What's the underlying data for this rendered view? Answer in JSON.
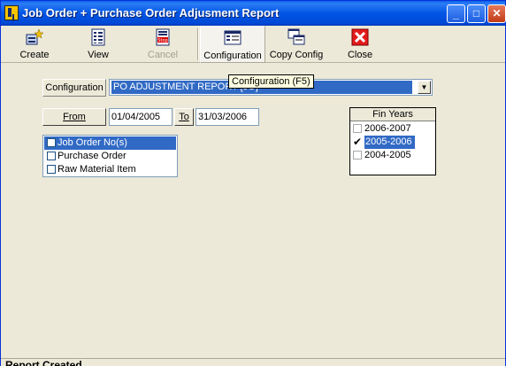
{
  "window": {
    "title": "Job Order + Purchase Order Adjusment Report",
    "controls": {
      "minimize": "_",
      "maximize": "□",
      "close": "✕"
    }
  },
  "toolbar": {
    "create_label": "Create",
    "view_label": "View",
    "cancel_label": "Cancel",
    "configuration_label": "Configuration",
    "copy_config_label": "Copy Config",
    "close_label": "Close"
  },
  "tooltip": {
    "text": "Configuration  (F5)"
  },
  "config": {
    "label": "Configuration",
    "selected_value": "PO ADJUSTMENT REPORT [JO]",
    "dropdown_arrow": "▼"
  },
  "dates": {
    "from_label": "From",
    "from_value": "01/04/2005",
    "to_label": "To",
    "to_value": "31/03/2006"
  },
  "filters": [
    {
      "label": "Job Order No(s)",
      "checked": false,
      "selected": true
    },
    {
      "label": "Purchase Order",
      "checked": false,
      "selected": false
    },
    {
      "label": "Raw Material Item",
      "checked": false,
      "selected": false
    }
  ],
  "fin_years": {
    "header": "Fin Years",
    "items": [
      {
        "label": "2006-2007",
        "checked": false,
        "selected": false
      },
      {
        "label": "2005-2006",
        "checked": true,
        "selected": true
      },
      {
        "label": "2004-2005",
        "checked": false,
        "selected": false
      }
    ]
  },
  "status": {
    "text": "Report Created"
  },
  "colors": {
    "title_blue": "#0055e5",
    "selection": "#316ac5",
    "tooltip_bg": "#ffffe1",
    "close_red": "#e31b1b"
  },
  "icons": [
    "app-icon",
    "create-icon",
    "view-icon",
    "cancel-stop-icon",
    "configuration-icon",
    "copy-config-icon",
    "close-x-icon"
  ]
}
